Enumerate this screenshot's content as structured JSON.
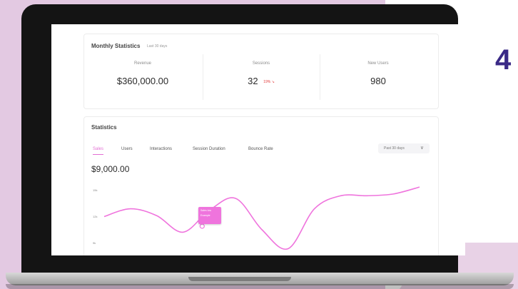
{
  "step": {
    "number": "4"
  },
  "monthly_statistics": {
    "title": "Monthly Statistics",
    "subtitle": "Last 30 days",
    "metrics": [
      {
        "label": "Revenue",
        "value": "$360,000.00"
      },
      {
        "label": "Sessions",
        "value": "32",
        "change": "19% ↘"
      },
      {
        "label": "New Users",
        "value": "980"
      }
    ]
  },
  "statistics": {
    "title": "Statistics",
    "tabs": [
      {
        "label": "Sales",
        "active": true
      },
      {
        "label": "Users"
      },
      {
        "label": "Interactions"
      },
      {
        "label": "Session Duration"
      },
      {
        "label": "Bounce Rate"
      }
    ],
    "period": {
      "selected": "Past 30 days"
    },
    "current_value": "$9,000.00",
    "y_ticks": [
      "15k",
      "12k",
      "9k"
    ],
    "tooltip": {
      "line1": "Sales low",
      "line2": "Example"
    }
  },
  "chart_data": {
    "type": "line",
    "series": [
      {
        "values": [
          12.0,
          12.9,
          12.1,
          10.2,
          12.7,
          14.1,
          10.5,
          8.3,
          12.9,
          14.4,
          14.4,
          14.6,
          15.4
        ]
      }
    ],
    "y_ticks": [
      "15k",
      "12k",
      "9k"
    ],
    "color": "#ef74dd"
  }
}
